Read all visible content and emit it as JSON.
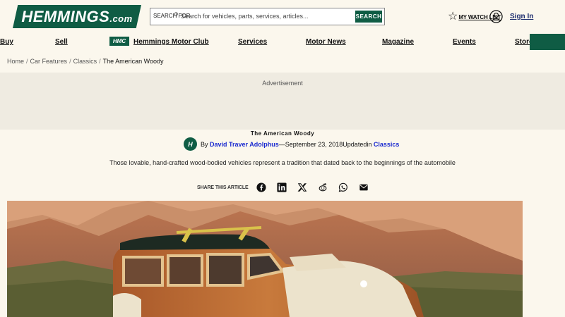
{
  "brand": {
    "logo_main": "HEMMINGS",
    "logo_suffix": ".com"
  },
  "search": {
    "label": "SEARCH FOR",
    "placeholder": "Search for vehicles, parts, services, articles...",
    "button": "SEARCH"
  },
  "header": {
    "watchlist": "MY WATCH LIST",
    "signin": "Sign In"
  },
  "nav": {
    "buy": "Buy",
    "sell": "Sell",
    "hmc_badge": "HMC",
    "motor_club": "Hemmings Motor Club",
    "services": "Services",
    "motor_news": "Motor News",
    "magazine": "Magazine",
    "events": "Events",
    "store": "Store"
  },
  "breadcrumb": {
    "home": "Home",
    "features": "Car Features",
    "classics": "Classics",
    "current": "The American Woody",
    "sep": "/"
  },
  "ad": {
    "label": "Advertisement"
  },
  "article": {
    "title": "The American Woody",
    "by": "By",
    "author": "David Traver Adolphus",
    "dash": "—",
    "date": "September 23, 2018",
    "updated": "Updated",
    "in": "in",
    "category": "Classics",
    "deck": "Those lovable, hand-crafted wood-bodied vehicles represent a tradition that dated back to the beginnings of the automobile"
  },
  "share": {
    "label": "SHARE THIS ARTICLE"
  },
  "colors": {
    "brand_green": "#0f5c44",
    "link_blue": "#1a2ad0",
    "page_bg": "#fbf7ed"
  }
}
